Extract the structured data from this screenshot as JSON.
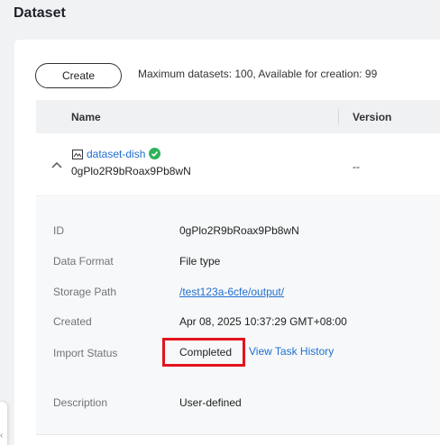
{
  "page": {
    "title": "Dataset"
  },
  "toolbar": {
    "create_label": "Create",
    "quota_text": "Maximum datasets: 100, Available for creation: 99"
  },
  "table": {
    "columns": [
      "Name",
      "Version"
    ],
    "row": {
      "name": "dataset-dish",
      "id": "0gPlo2R9bRoax9Pb8wN",
      "version": "--",
      "status_icon": "check-circle-icon",
      "type_icon": "chart-image-icon",
      "expand_icon": "chevron-up-icon"
    }
  },
  "details": {
    "fields": [
      {
        "label": "ID",
        "value": "0gPlo2R9bRoax9Pb8wN"
      },
      {
        "label": "Data Format",
        "value": "File type"
      },
      {
        "label": "Storage Path",
        "value": "/test123a-6cfe/output/"
      },
      {
        "label": "Created",
        "value": "Apr 08, 2025 10:37:29 GMT+08:00"
      },
      {
        "label": "Import Status",
        "value": "Completed"
      },
      {
        "label": "Description",
        "value": "User-defined"
      }
    ],
    "task_history_label": "View Task History"
  },
  "colors": {
    "link": "#1f6fd1",
    "success": "#2fb15a",
    "highlight": "#e1131d"
  }
}
